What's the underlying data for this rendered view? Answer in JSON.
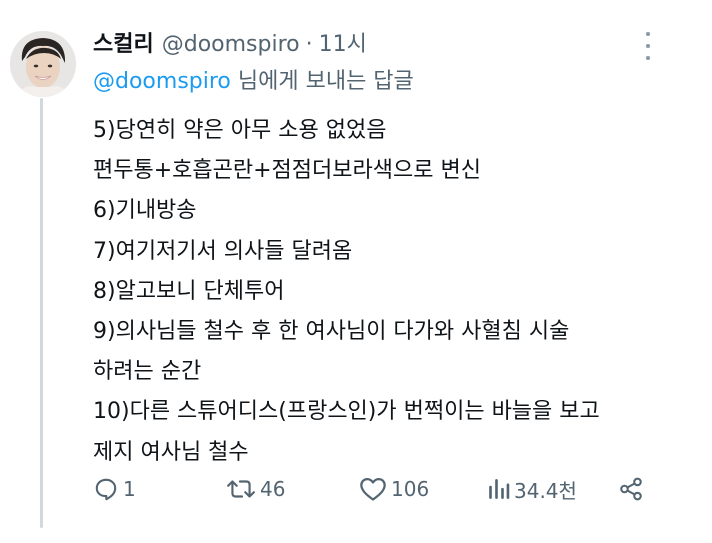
{
  "author": {
    "display_name": "스컬리",
    "handle": "@doomspiro",
    "separator": "·",
    "time": "11시"
  },
  "reply": {
    "mention": "@doomspiro",
    "suffix": " 님에게 보내는 답글"
  },
  "body_lines": [
    "5)당연히 약은 아무 소용 없었음",
    "편두통+호흡곤란+점점더보라색으로 변신",
    "6)기내방송",
    "7)여기저기서 의사들 달려옴",
    "8)알고보니 단체투어",
    "9)의사님들 철수 후 한 여사님이 다가와 사혈침 시술",
    "하려는 순간",
    "10)다른 스튜어디스(프랑스인)가 번쩍이는 바늘을 보고",
    "제지 여사님 철수"
  ],
  "actions": {
    "replies": "1",
    "reposts": "46",
    "likes": "106",
    "views": "34.4천"
  },
  "icons": {
    "reply": "reply-icon",
    "repost": "repost-icon",
    "like": "heart-icon",
    "views": "views-icon",
    "share": "share-icon",
    "more": "more-icon"
  },
  "colors": {
    "text": "#0f1419",
    "secondary": "#536471",
    "accent": "#1d9bf0",
    "thread_line": "#cfd9de"
  }
}
